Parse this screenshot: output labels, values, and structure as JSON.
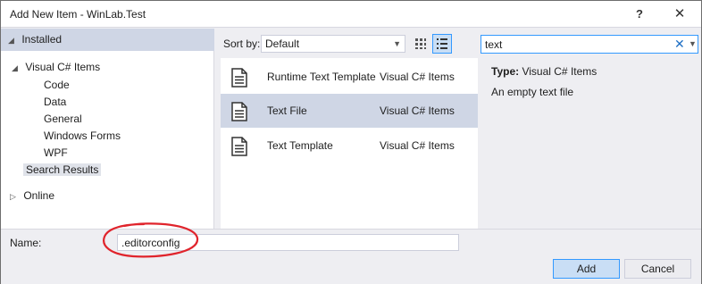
{
  "window": {
    "title": "Add New Item - WinLab.Test",
    "help_label": "?",
    "close_label": "✕"
  },
  "tree": {
    "installed_label": "Installed",
    "visual_csharp_label": "Visual C# Items",
    "children": [
      "Code",
      "Data",
      "General",
      "Windows Forms",
      "WPF"
    ],
    "search_results_label": "Search Results",
    "online_label": "Online"
  },
  "toolbar": {
    "sort_label": "Sort by:",
    "sort_value": "Default"
  },
  "templates": [
    {
      "name": "Runtime Text Template",
      "category": "Visual C# Items",
      "selected": false
    },
    {
      "name": "Text File",
      "category": "Visual C# Items",
      "selected": true
    },
    {
      "name": "Text Template",
      "category": "Visual C# Items",
      "selected": false
    }
  ],
  "search": {
    "value": "text"
  },
  "details": {
    "type_key": "Type:",
    "type_value": "Visual C# Items",
    "description": "An empty text file"
  },
  "footer": {
    "name_label": "Name:",
    "name_value": ".editorconfig",
    "add_label": "Add",
    "cancel_label": "Cancel"
  },
  "colors": {
    "selection": "#cfd6e5",
    "accent": "#3399ff",
    "annotation_circle": "#e0242c"
  },
  "icons": {
    "help": "help-icon",
    "close": "close-icon",
    "tree_expanded": "tree-expanded-icon",
    "tree_collapsed": "tree-collapsed-icon",
    "view_small_icons": "small-icons-view-icon",
    "view_list": "list-view-icon",
    "file_template": "text-file-icon"
  }
}
